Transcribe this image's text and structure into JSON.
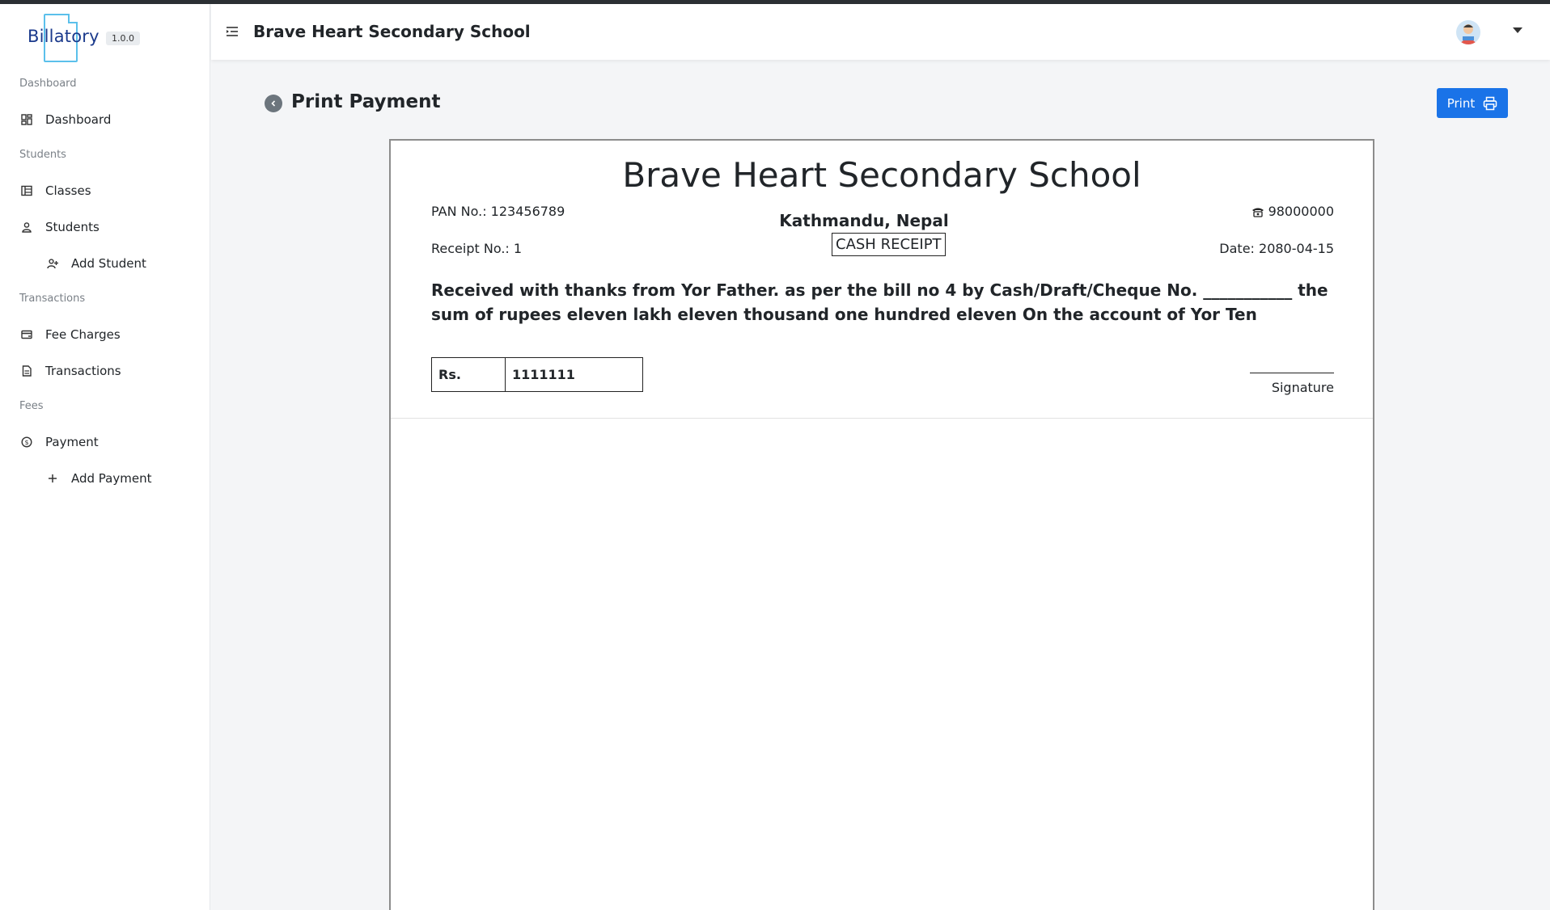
{
  "brand": {
    "name": "Billatory",
    "version": "1.0.0"
  },
  "sidebar": {
    "sections": [
      {
        "label": "Dashboard"
      },
      {
        "label": "Students"
      },
      {
        "label": "Transactions"
      },
      {
        "label": "Fees"
      }
    ],
    "items": [
      {
        "label": "Dashboard",
        "icon": "dashboard-icon"
      },
      {
        "label": "Classes",
        "icon": "table-icon"
      },
      {
        "label": "Students",
        "icon": "user-icon"
      },
      {
        "label": "Add Student",
        "icon": "user-plus-icon"
      },
      {
        "label": "Fee Charges",
        "icon": "card-icon"
      },
      {
        "label": "Transactions",
        "icon": "document-icon"
      },
      {
        "label": "Payment",
        "icon": "dollar-circle-icon"
      },
      {
        "label": "Add Payment",
        "icon": "plus-icon"
      }
    ]
  },
  "header": {
    "title": "Brave Heart Secondary School"
  },
  "page": {
    "title": "Print Payment",
    "print_label": "Print"
  },
  "receipt": {
    "school_name": "Brave Heart Secondary School",
    "pan": "PAN No.: 123456789",
    "phone": "98000000",
    "address": "Kathmandu, Nepal",
    "type": "CASH RECEIPT",
    "receipt_no": "Receipt No.: 1",
    "date": "Date: 2080-04-15",
    "received_text": "Received with thanks from Yor Father. as per the bill no 4 by Cash/Draft/Cheque No. ___________ the sum of rupees eleven lakh eleven thousand one hundred eleven On the account of Yor Ten",
    "amount_label": "Rs.",
    "amount_value": "1111111",
    "signature_label": "Signature"
  },
  "colors": {
    "primary": "#1a73e8",
    "brand_text": "#1b3a8c",
    "brand_accent": "#5bc0eb"
  }
}
